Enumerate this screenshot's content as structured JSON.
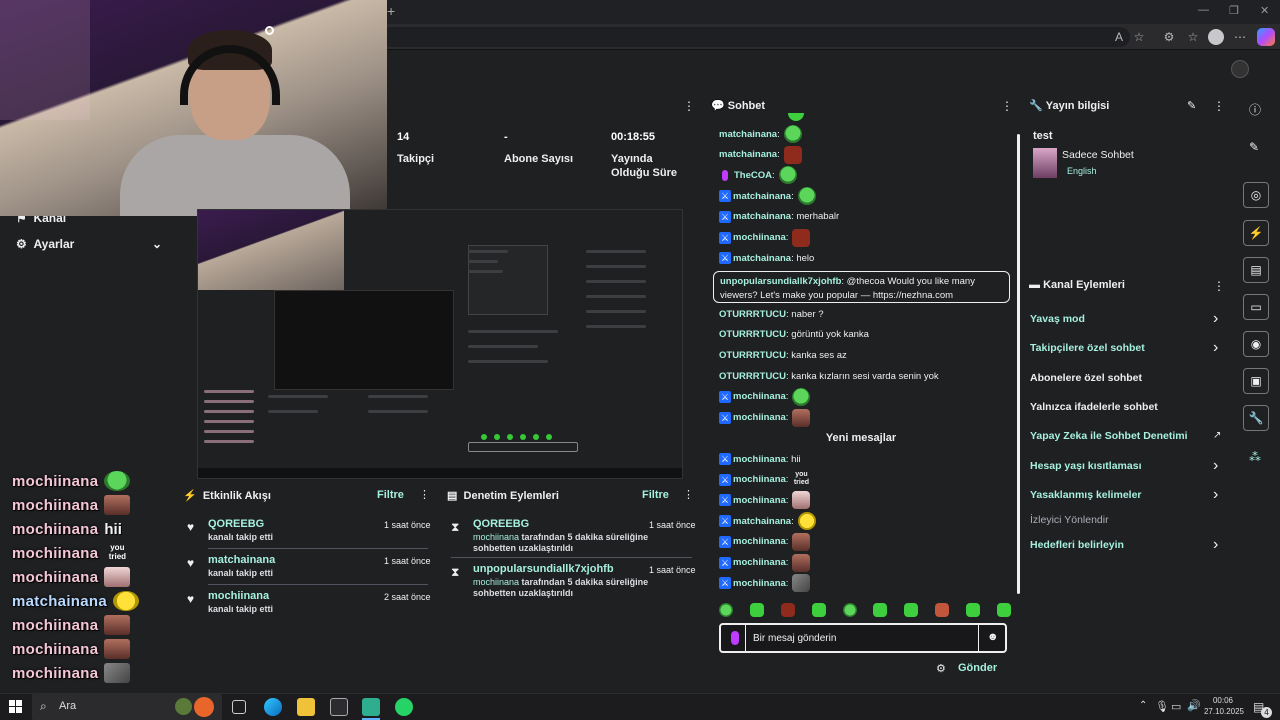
{
  "browser": {
    "new_tab": "+",
    "win_min": "—",
    "win_max": "❐",
    "win_close": "✕",
    "toolbar_icons": [
      "read-aloud-icon",
      "star-icon",
      "extensions-icon",
      "favorites-icon",
      "profile-icon",
      "more-icon",
      "copilot-icon"
    ]
  },
  "stats": [
    {
      "value": "14",
      "label": "Takipçi"
    },
    {
      "value": "-",
      "label": "Abone Sayısı"
    },
    {
      "value": "00:18:55",
      "label": "Yayında Olduğu Süre"
    }
  ],
  "nav": {
    "channel": "Kanal",
    "settings": "Ayarlar"
  },
  "overlay_chat": [
    {
      "name": "mochiinana",
      "text": "",
      "emote": "pepe"
    },
    {
      "name": "mochiinana",
      "text": "",
      "emote": "face"
    },
    {
      "name": "mochiinana",
      "text": "hii",
      "emote": ""
    },
    {
      "name": "mochiinana",
      "text": "",
      "emote": "you-tried"
    },
    {
      "name": "mochiinana",
      "text": "",
      "emote": "cat"
    },
    {
      "name": "matchainana",
      "text": "",
      "emote": "yellow"
    },
    {
      "name": "mochiinana",
      "text": "",
      "emote": "man"
    },
    {
      "name": "mochiinana",
      "text": "",
      "emote": "face"
    },
    {
      "name": "mochiinana",
      "text": "",
      "emote": "grey"
    }
  ],
  "activity_feed": {
    "title": "Etkinlik Akışı",
    "filter": "Filtre",
    "items": [
      {
        "user": "QOREEBG",
        "desc": "kanalı takip etti",
        "time": "1 saat önce"
      },
      {
        "user": "matchainana",
        "desc": "kanalı takip etti",
        "time": "1 saat önce"
      },
      {
        "user": "mochiinana",
        "desc": "kanalı takip etti",
        "time": "2 saat önce"
      }
    ]
  },
  "mod_actions": {
    "title": "Denetim Eylemleri",
    "filter": "Filtre",
    "items": [
      {
        "user": "QOREEBG",
        "by": "mochiinana",
        "desc": "tarafından 5 dakika süreliğine sohbetten uzaklaştırıldı",
        "time": "1 saat önce"
      },
      {
        "user": "unpopularsundiallk7xjohfb",
        "by": "mochiinana",
        "desc": "tarafından 5 dakika süreliğine sohbetten uzaklaştırıldı",
        "time": "1 saat önce"
      }
    ]
  },
  "chat": {
    "title": "Sohbet",
    "messages": [
      {
        "name": "matchainana",
        "text": ":",
        "emote": "green",
        "badge": ""
      },
      {
        "name": "matchainana",
        "text": ":",
        "emote": "red",
        "badge": ""
      },
      {
        "name": "TheCOA",
        "text": ":",
        "emote": "green",
        "badge": "mic"
      },
      {
        "name": "matchainana",
        "text": ":",
        "emote": "green",
        "badge": "mod"
      },
      {
        "name": "matchainana",
        "text": ": merhabalr",
        "emote": "",
        "badge": "mod"
      },
      {
        "name": "mochiinana",
        "text": ":",
        "emote": "red",
        "badge": "mod"
      },
      {
        "name": "matchainana",
        "text": ": helo",
        "emote": "",
        "badge": "mod"
      }
    ],
    "mention": {
      "name": "unpopularsundiallk7xjohfb",
      "text": ": @thecoa Would you like many viewers? Let's make you popular — https://nezhna.com"
    },
    "messages2": [
      {
        "name": "OTURRRTUCU",
        "text": ": naber ?",
        "emote": "",
        "badge": ""
      },
      {
        "name": "OTURRRTUCU",
        "text": ": görüntü yok kanka",
        "emote": "",
        "badge": ""
      },
      {
        "name": "OTURRRTUCU",
        "text": ": kanka ses az",
        "emote": "",
        "badge": ""
      },
      {
        "name": "OTURRRTUCU",
        "text": ": kanka kızların sesi varda senin yok",
        "emote": "",
        "badge": ""
      },
      {
        "name": "mochiinana",
        "text": ":",
        "emote": "green",
        "badge": "mod"
      },
      {
        "name": "mochiinana",
        "text": ":",
        "emote": "face",
        "badge": "mod"
      }
    ],
    "new_messages": "Yeni mesajlar",
    "messages3": [
      {
        "name": "mochiinana",
        "text": ": hii",
        "emote": "",
        "badge": "mod"
      },
      {
        "name": "mochiinana",
        "text": ":",
        "emote": "you-tried",
        "badge": "mod"
      },
      {
        "name": "mochiinana",
        "text": ":",
        "emote": "pink",
        "badge": "mod"
      },
      {
        "name": "matchainana",
        "text": ":",
        "emote": "yellow",
        "badge": "mod"
      },
      {
        "name": "mochiinana",
        "text": ":",
        "emote": "face",
        "badge": "mod"
      },
      {
        "name": "mochiinana",
        "text": ":",
        "emote": "face",
        "badge": "mod"
      },
      {
        "name": "mochiinana",
        "text": ":",
        "emote": "grey",
        "badge": "mod"
      }
    ],
    "you_tried": "you tried",
    "input_placeholder": "Bir mesaj gönderin",
    "send": "Gönder"
  },
  "stream_info": {
    "title": "Yayın bilgisi",
    "stream_title": "test",
    "category": "Sadece Sohbet",
    "language": "English"
  },
  "channel_actions": {
    "title": "Kanal Eylemleri",
    "items": [
      {
        "label": "Yavaş mod",
        "style": "accent",
        "chevron": true
      },
      {
        "label": "Takipçilere özel sohbet",
        "style": "accent",
        "chevron": true
      },
      {
        "label": "Abonelere özel sohbet",
        "style": "white",
        "chevron": false
      },
      {
        "label": "Yalnızca ifadelerle sohbet",
        "style": "white",
        "chevron": false
      },
      {
        "label": "Yapay Zeka ile Sohbet Denetimi",
        "style": "accent",
        "chevron": false,
        "external": true
      },
      {
        "label": "Hesap yaşı kısıtlaması",
        "style": "accent",
        "chevron": true
      },
      {
        "label": "Yasaklanmış kelimeler",
        "style": "accent",
        "chevron": true
      },
      {
        "label": "İzleyici Yönlendir",
        "style": "grey",
        "chevron": false
      },
      {
        "label": "Hedefleri belirleyin",
        "style": "accent",
        "chevron": true
      }
    ]
  },
  "taskbar": {
    "search_placeholder": "Ara",
    "time": "00:06",
    "date": "27.10.2025",
    "notification_count": "4"
  },
  "colors": {
    "accent": "#a6f0de",
    "mod_badge": "#1f69ff",
    "background": "#1f2022"
  }
}
